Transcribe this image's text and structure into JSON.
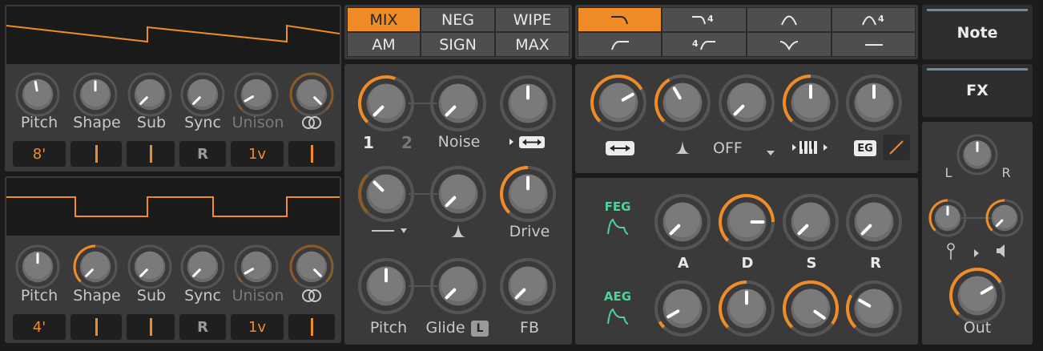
{
  "colors": {
    "accent": "#f08c28",
    "panel": "#3a3a3a",
    "background": "#1b1b1b",
    "envelope": "#4ed29a",
    "side_bar": "#6a8ea0"
  },
  "osc1": {
    "pitch_label": "Pitch",
    "shape_label": "Shape",
    "sub_label": "Sub",
    "sync_label": "Sync",
    "unison_label": "Unison",
    "pitch_value": "8'",
    "sync_value": "R",
    "unison_value": "1v",
    "link_icon": "rings-icon"
  },
  "osc2": {
    "pitch_label": "Pitch",
    "shape_label": "Shape",
    "sub_label": "Sub",
    "sync_label": "Sync",
    "unison_label": "Unison",
    "pitch_value": "4'",
    "sync_value": "R",
    "unison_value": "1v",
    "link_icon": "rings-icon"
  },
  "mix_modes": [
    "MIX",
    "NEG",
    "WIPE",
    "AM",
    "SIGN",
    "MAX"
  ],
  "mix_mode_selected": "MIX",
  "mixer": {
    "osc1_label": "1",
    "osc2_label": "2",
    "noise_label": "Noise",
    "drive_label": "Drive",
    "pitch_label": "Pitch",
    "glide_label": "Glide",
    "glide_badge": "L",
    "fb_label": "FB",
    "noise_mode_icon": "stereo-arrows-icon",
    "filter_mode_icon": "dash-icon",
    "resonance_icon": "peak-icon"
  },
  "filter_types": [
    "lowpass-icon",
    "lowpass-4pole-icon",
    "bandpass-icon",
    "bandpass-4pole-icon",
    "highpass-icon",
    "highpass-4pole-icon",
    "notch-icon",
    "off-line-icon"
  ],
  "filter_type_selected": "lowpass-icon",
  "filter": {
    "stereo_icon": "stereo-arrows-icon",
    "resonance_icon": "peak-icon",
    "keytrack_value": "OFF",
    "keyboard_icon": "keyboard-icon",
    "eg_badge": "EG",
    "eg_slope_icon": "diagonal-line-icon"
  },
  "envelopes": {
    "feg_label": "FEG",
    "aeg_label": "AEG",
    "a_label": "A",
    "d_label": "D",
    "s_label": "S",
    "r_label": "R"
  },
  "side": {
    "note_label": "Note",
    "fx_label": "FX",
    "left_label": "L",
    "right_label": "R",
    "out_label": "Out"
  }
}
